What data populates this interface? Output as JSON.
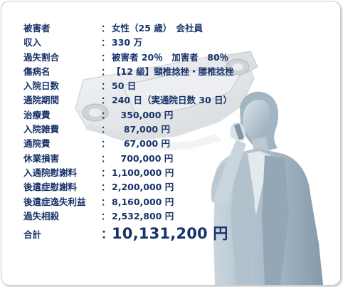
{
  "colors": {
    "text": "#18336a",
    "border": "#c9c9c9",
    "figure": "#a9b8c4",
    "car": "#d7dadd"
  },
  "illustration": {
    "car_icon": "overturned-car-icon",
    "person_icon": "woman-on-phone-icon"
  },
  "rows": [
    {
      "label": "被害者",
      "sep": "：",
      "value": "女性（25 歳）　会社員"
    },
    {
      "label": "収入",
      "sep": "：",
      "value": "330 万"
    },
    {
      "label": "過失割合",
      "sep": "：",
      "value": "被害者 20％　加害者　80％"
    },
    {
      "label": "傷病名",
      "sep": "：",
      "value": "【12 級】頸椎捻挫・腰椎捻挫"
    },
    {
      "label": "入院日数",
      "sep": "：",
      "value": "50 日"
    },
    {
      "label": "通院期間",
      "sep": "：",
      "value": "240 日（実通院日数 30 日）"
    },
    {
      "label": "治療費",
      "sep": "：",
      "value": "　350,000 円"
    },
    {
      "label": "入院雑費",
      "sep": "：",
      "value": "　 87,000 円"
    },
    {
      "label": "通院費",
      "sep": "：",
      "value": "　 67,000 円"
    },
    {
      "label": "休業損害",
      "sep": "：",
      "value": "　700,000 円"
    },
    {
      "label": "入通院慰謝料",
      "sep": "：",
      "value": "1,100,000 円"
    },
    {
      "label": "後遺症慰謝料",
      "sep": "：",
      "value": "2,200,000 円"
    },
    {
      "label": "後遺症逸失利益",
      "sep": "：",
      "value": "8,160,000 円"
    },
    {
      "label": "過失相殺",
      "sep": "：",
      "value": "2,532,800 円"
    }
  ],
  "total": {
    "label": "合計",
    "sep": "：",
    "value": "10,131,200 円"
  }
}
